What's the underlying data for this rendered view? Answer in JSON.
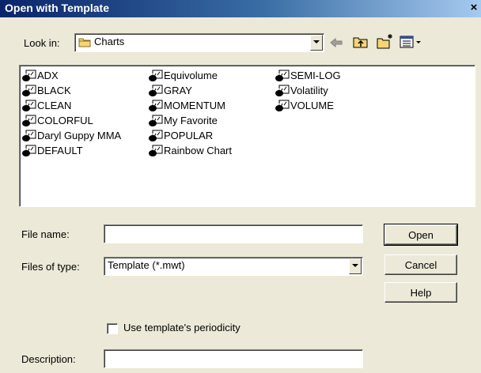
{
  "window": {
    "title": "Open with Template",
    "close_glyph": "×"
  },
  "look_in": {
    "label": "Look in:",
    "value": "Charts",
    "icon": "folder-icon"
  },
  "toolbar": {
    "back_icon": "back-arrow-icon",
    "up_icon": "up-folder-icon",
    "new_folder_icon": "new-folder-icon",
    "view_menu_icon": "view-menu-icon"
  },
  "files": [
    {
      "label": "ADX"
    },
    {
      "label": "BLACK"
    },
    {
      "label": "CLEAN"
    },
    {
      "label": "COLORFUL"
    },
    {
      "label": "Daryl Guppy MMA"
    },
    {
      "label": "DEFAULT"
    },
    {
      "label": "Equivolume"
    },
    {
      "label": "GRAY"
    },
    {
      "label": "MOMENTUM"
    },
    {
      "label": "My Favorite"
    },
    {
      "label": "POPULAR"
    },
    {
      "label": "Rainbow Chart"
    },
    {
      "label": "SEMI-LOG"
    },
    {
      "label": "Volatility"
    },
    {
      "label": "VOLUME"
    }
  ],
  "file_name": {
    "label": "File name:",
    "value": ""
  },
  "file_type": {
    "label": "Files of type:",
    "value": "Template (*.mwt)"
  },
  "buttons": {
    "open": "Open",
    "cancel": "Cancel",
    "help": "Help"
  },
  "periodicity": {
    "label": "Use template's periodicity",
    "checked": false
  },
  "description": {
    "label": "Description:",
    "value": ""
  },
  "colors": {
    "title_start": "#0a246a",
    "title_end": "#a6caf0",
    "dialog_bg": "#ece9d8"
  }
}
